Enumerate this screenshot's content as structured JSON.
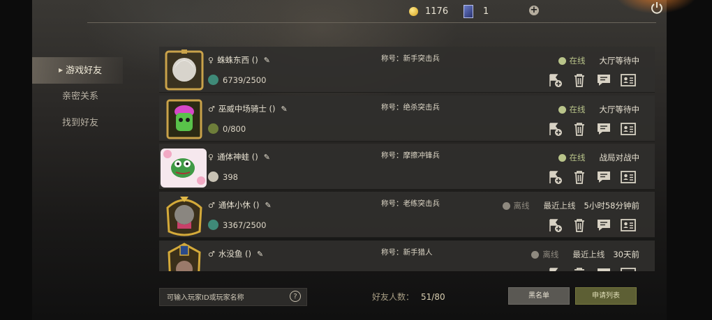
{
  "currency": {
    "coins": "1176",
    "cards": "1"
  },
  "nav": [
    {
      "label": "游戏好友",
      "active": true
    },
    {
      "label": "亲密关系",
      "active": false
    },
    {
      "label": "找到好友",
      "active": false
    }
  ],
  "friends": [
    {
      "name": "蛛蛛东西 ()",
      "gender": "♀",
      "title": "称号：新手突击兵",
      "level": "6739/2500",
      "status": "在线",
      "online": true,
      "activity": "大厅等待中",
      "last_label": "",
      "last_time": ""
    },
    {
      "name": "巫威中场骑士 ()",
      "gender": "♂",
      "title": "称号：绝杀突击兵",
      "level": "0/800",
      "status": "在线",
      "online": true,
      "activity": "大厅等待中",
      "last_label": "",
      "last_time": ""
    },
    {
      "name": "通体神蛙 ()",
      "gender": "♀",
      "title": "称号：摩擦冲锋兵",
      "level": "398",
      "status": "在线",
      "online": true,
      "activity": "战局对战中",
      "last_label": "",
      "last_time": ""
    },
    {
      "name": "通体小休 ()",
      "gender": "♂",
      "title": "称号：老练突击兵",
      "level": "3367/2500",
      "status": "离线",
      "online": false,
      "activity": "",
      "last_label": "最近上线",
      "last_time": "5小时58分钟前"
    },
    {
      "name": "水没鱼 ()",
      "gender": "♂",
      "title": "称号：新手猎人",
      "level": "",
      "status": "离线",
      "online": false,
      "activity": "",
      "last_label": "最近上线",
      "last_time": "30天前"
    }
  ],
  "search": {
    "placeholder": "可输入玩家ID或玩家名称"
  },
  "footer": {
    "count_label": "好友人数：",
    "count_value": "51/80",
    "blacklist": "黑名单",
    "apply_list": "申请列表"
  },
  "icons": [
    "coin-icon",
    "card-icon",
    "plus-icon",
    "power-icon",
    "female-icon",
    "male-icon",
    "edit-icon",
    "flag-add-icon",
    "trash-icon",
    "chat-icon",
    "profile-card-icon",
    "help-icon"
  ],
  "colors": {
    "online": "#b9c48a",
    "offline": "#8e897f",
    "apply_button": "#5d5f34"
  }
}
